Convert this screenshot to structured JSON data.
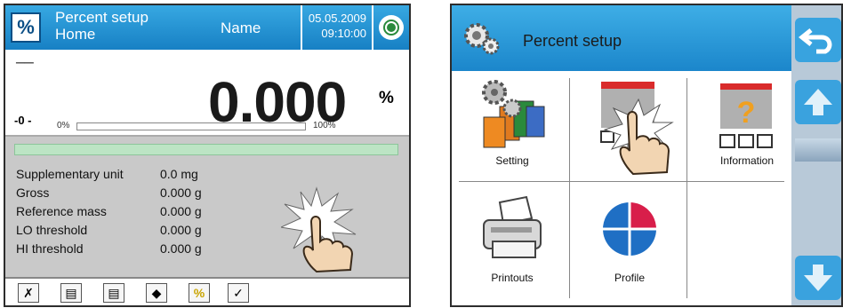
{
  "left_screen": {
    "header": {
      "mode_icon": "percent-icon",
      "title_line1": "Percent setup",
      "title_line2": "Home",
      "user": "Name",
      "date": "05.05.2009",
      "time": "09:10:00"
    },
    "display": {
      "stability": "──",
      "zero": "-0 -",
      "value": "0.000",
      "unit": "%",
      "bar_min": "0%",
      "bar_max": "100%",
      "bar_fill": 0
    },
    "info": {
      "rows": [
        {
          "label": "Supplementary unit",
          "value": "0.0 mg"
        },
        {
          "label": "Gross",
          "value": "0.000 g"
        },
        {
          "label": "Reference mass",
          "value": "0.000 g"
        },
        {
          "label": "LO threshold",
          "value": "0.000 g"
        },
        {
          "label": "HI threshold",
          "value": "0.000 g"
        }
      ]
    },
    "footer_icons": [
      "tools-icon",
      "printer-header-icon",
      "printer-footer-icon",
      "package-icon",
      "percent-reference-icon",
      "calibration-icon"
    ]
  },
  "right_screen": {
    "header": {
      "title": "Percent setup",
      "icon": "gears-icon"
    },
    "tiles": [
      {
        "label": "Setting",
        "icon": "settings-icon"
      },
      {
        "label": "",
        "icon": "display-icon"
      },
      {
        "label": "Information",
        "icon": "information-icon"
      },
      {
        "label": "Printouts",
        "icon": "printer-icon"
      },
      {
        "label": "Profile",
        "icon": "profile-icon"
      }
    ],
    "side_buttons": [
      "back-arrow-icon",
      "up-arrow-icon",
      "down-arrow-icon"
    ]
  },
  "colors": {
    "header_blue": "#1b86cb",
    "info_bg": "#c9c9c9",
    "accent_red": "#d92b2b",
    "green": "#2a8a3c"
  }
}
